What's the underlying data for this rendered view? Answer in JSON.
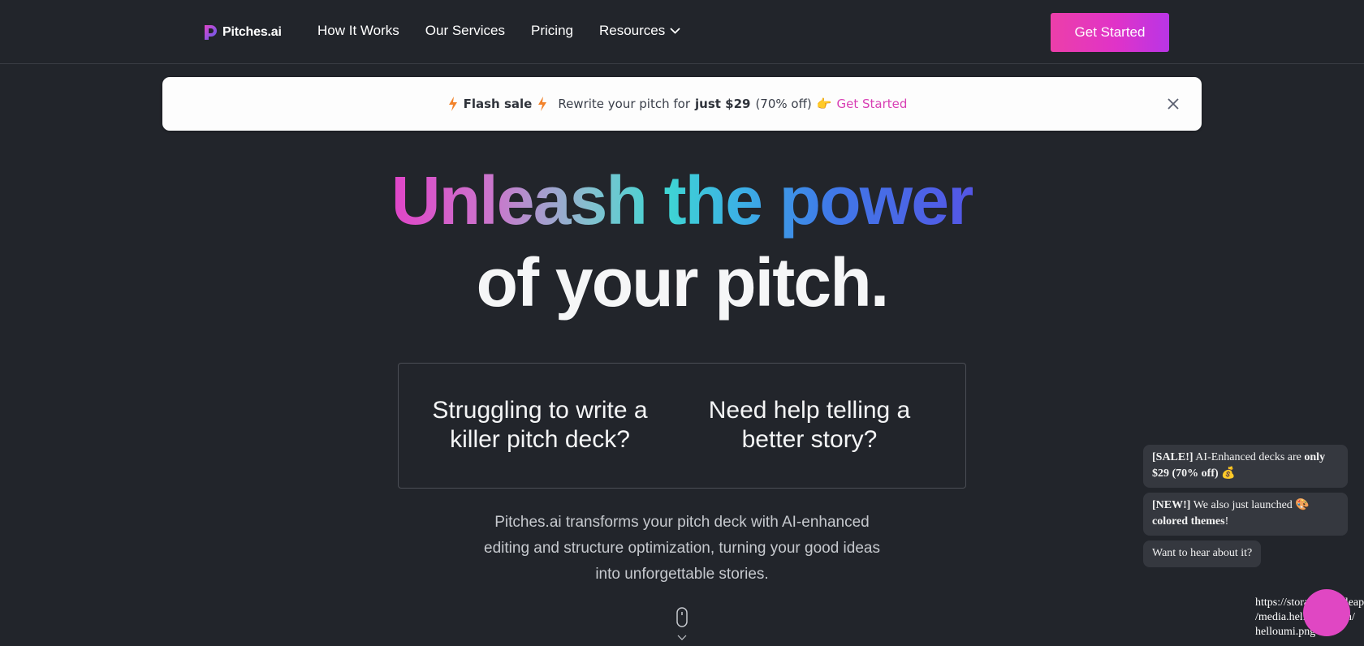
{
  "nav": {
    "logo_text": "Pitches.ai",
    "links": [
      {
        "label": "How It Works"
      },
      {
        "label": "Our Services"
      },
      {
        "label": "Pricing"
      },
      {
        "label": "Resources"
      }
    ],
    "cta_label": "Get Started"
  },
  "banner": {
    "flash_label": "Flash sale",
    "text_pre": "Rewrite your pitch for",
    "price_text": "just $29",
    "discount_text": "(70% off)",
    "pointer_emoji": "👉",
    "link_label": "Get Started"
  },
  "hero": {
    "words_gradient": "Unleash the power",
    "line2": "of your pitch."
  },
  "pain_points": [
    "Struggling to write a killer pitch deck?",
    "Need help telling a better story?"
  ],
  "description": "Pitches.ai transforms your pitch deck with AI-enhanced editing and structure optimization, turning your good ideas into unforgettable stories.",
  "chat": {
    "msg1_tag": "[SALE!]",
    "msg1_text": "AI-Enhanced decks are",
    "msg1_bold": "only $29 (70% off)",
    "msg1_emoji": "💰",
    "msg2_tag": "[NEW!]",
    "msg2_text": "We also just launched",
    "msg2_emoji": "🎨",
    "msg2_bold": "colored themes",
    "msg2_end": "!",
    "msg3": "Want to hear about it?",
    "image_url_text": "https://storage.googleapis.com/media.helloumi.com/helloumi.png"
  },
  "colors": {
    "background": "#22252b",
    "accent_pink": "#e033c8",
    "banner_link": "#d83fb4"
  }
}
